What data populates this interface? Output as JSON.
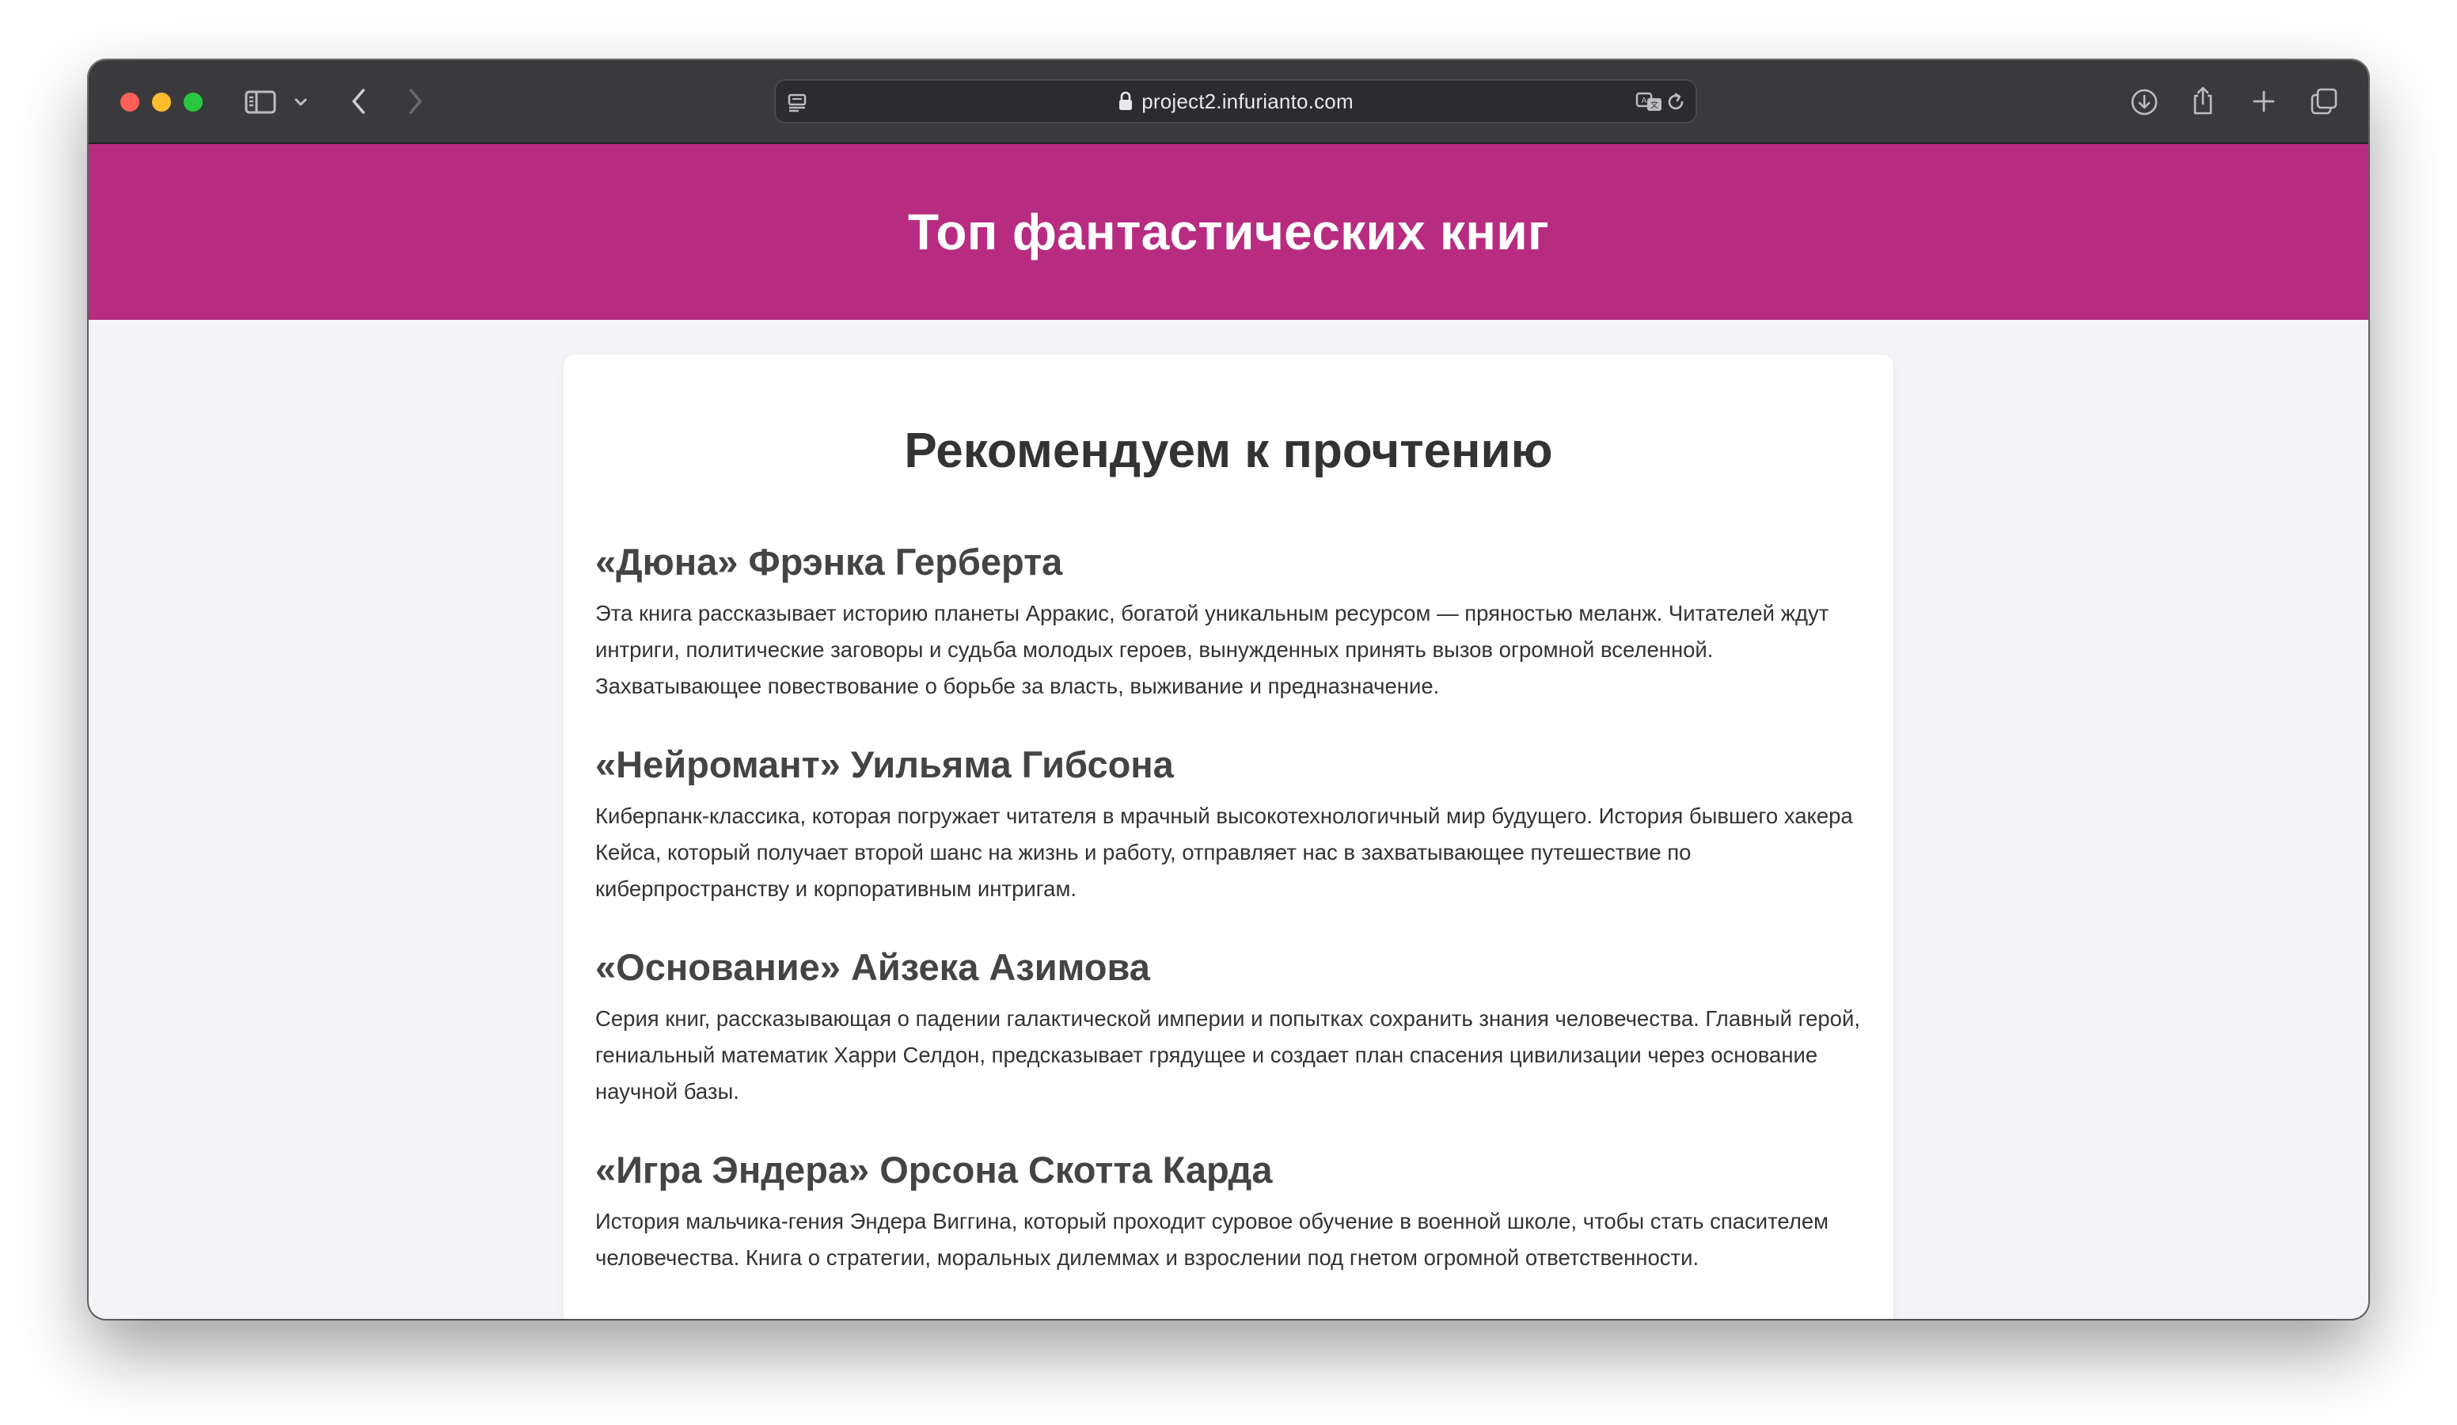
{
  "browser": {
    "url": "project2.infurianto.com"
  },
  "page": {
    "title": "Топ фантастических книг",
    "section_title": "Рекомендуем к прочтению",
    "books": [
      {
        "title": "«Дюна» Фрэнка Герберта",
        "description": "Эта книга рассказывает историю планеты Арракис, богатой уникальным ресурсом — пряностью меланж. Читателей ждут интриги, политические заговоры и судьба молодых героев, вынужденных принять вызов огромной вселенной. Захватывающее повествование о борьбе за власть, выживание и предназначение."
      },
      {
        "title": "«Нейромант» Уильяма Гибсона",
        "description": "Киберпанк-классика, которая погружает читателя в мрачный высокотехнологичный мир будущего. История бывшего хакера Кейса, который получает второй шанс на жизнь и работу, отправляет нас в захватывающее путешествие по киберпространству и корпоративным интригам."
      },
      {
        "title": "«Основание» Айзека Азимова",
        "description": "Серия книг, рассказывающая о падении галактической империи и попытках сохранить знания человечества. Главный герой, гениальный математик Харри Селдон, предсказывает грядущее и создает план спасения цивилизации через основание научной базы."
      },
      {
        "title": "«Игра Эндера» Орсона Скотта Карда",
        "description": "История мальчика-гения Эндера Виггина, который проходит суровое обучение в военной школе, чтобы стать спасителем человечества. Книга о стратегии, моральных дилеммах и взрослении под гнетом огромной ответственности."
      }
    ]
  },
  "colors": {
    "header_bg": "#b72c80",
    "page_bg": "#f3f3f8",
    "toolbar_bg": "#3a3a3c"
  },
  "icons": {
    "sidebar": "sidebar-icon",
    "chevron": "chevron-down-icon",
    "back": "back-arrow-icon",
    "forward": "forward-arrow-icon",
    "reader": "reader-mode-icon",
    "lock": "lock-icon",
    "translate": "translate-icon",
    "reload": "reload-icon",
    "downloads": "download-icon",
    "share": "share-icon",
    "new_tab": "plus-icon",
    "tabs": "tab-overview-icon"
  }
}
